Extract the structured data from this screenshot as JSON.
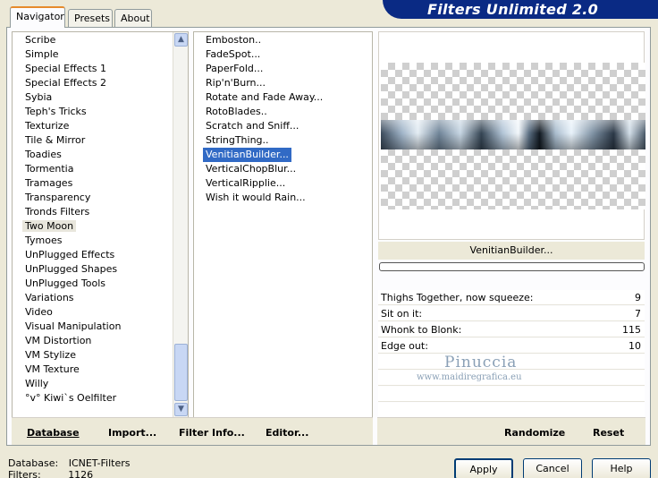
{
  "tabs": [
    {
      "label": "Navigator"
    },
    {
      "label": "Presets"
    },
    {
      "label": "About"
    }
  ],
  "banner": "Filters Unlimited 2.0",
  "categories": [
    "Scribe",
    "Simple",
    "Special Effects 1",
    "Special Effects 2",
    "Sybia",
    "Teph's Tricks",
    "Texturize",
    "Tile & Mirror",
    "Toadies",
    "Tormentia",
    "Tramages",
    "Transparency",
    "Tronds Filters",
    "Two Moon",
    "Tymoes",
    "UnPlugged Effects",
    "UnPlugged Shapes",
    "UnPlugged Tools",
    "Variations",
    "Video",
    "Visual Manipulation",
    "VM Distortion",
    "VM Stylize",
    "VM Texture",
    "Willy",
    "°v° Kiwi`s Oelfilter"
  ],
  "selected_category": "Two Moon",
  "filters": [
    "Emboston..",
    "FadeSpot...",
    "PaperFold...",
    "Rip'n'Burn...",
    "Rotate and Fade Away...",
    "RotoBlades..",
    "Scratch and Sniff...",
    "StringThing..",
    "VenitianBuilder...",
    "VerticalChopBlur...",
    "VerticalRipplie...",
    "Wish it would Rain..."
  ],
  "selected_filter": "VenitianBuilder...",
  "preview_filter_name": "VenitianBuilder...",
  "params": [
    {
      "label": "Thighs Together, now squeeze:",
      "value": "9"
    },
    {
      "label": "Sit on it:",
      "value": "7"
    },
    {
      "label": "Whonk to Blonk:",
      "value": "115"
    },
    {
      "label": "Edge out:",
      "value": "10"
    }
  ],
  "watermark": {
    "name": "Pinuccia",
    "url": "www.maidiregrafica.eu"
  },
  "bottom_left": {
    "database": "Database",
    "import": "Import...",
    "filter_info": "Filter Info...",
    "editor": "Editor..."
  },
  "bottom_right": {
    "randomize": "Randomize",
    "reset": "Reset"
  },
  "status": {
    "database_label": "Database:",
    "database_value": "ICNET-Filters",
    "filters_label": "Filters:",
    "filters_value": "1126"
  },
  "buttons": {
    "apply": "Apply",
    "cancel": "Cancel",
    "help": "Help"
  },
  "colors": {
    "banner": "#0a2a84",
    "selection": "#316ac5",
    "tab_highlight": "#e68b2c"
  }
}
